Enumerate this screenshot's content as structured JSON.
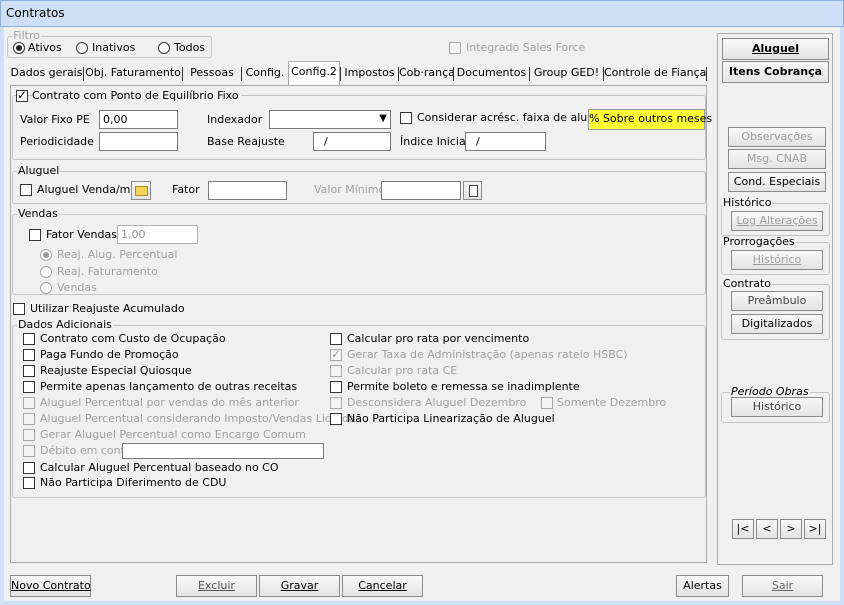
{
  "window": {
    "title": "Contratos"
  },
  "filtro": {
    "legend": "Filtro",
    "options": [
      "Ativos",
      "Inativos",
      "Todos"
    ],
    "selected": "Ativos",
    "integrado_label": "Integrado Sales Force"
  },
  "tabs": [
    "Dados gerais",
    "Obj. Faturamento",
    "Pessoas",
    "Config.",
    "Config.2",
    "Impostos",
    "Cob·rança",
    "Documentos",
    "Group GED!",
    "Controle de Fiança"
  ],
  "active_tab": "Config.2",
  "pe": {
    "legend": "Contrato com Ponto de Equilíbrio Fixo",
    "valor_fixo_label": "Valor Fixo PE",
    "valor_fixo_value": "0,00",
    "indexador_label": "Indexador",
    "indexador_value": "",
    "considerar_label": "Considerar acrésc. faixa de aluguel",
    "sobre_button": "% Sobre outros meses",
    "periodicidade_label": "Periodicidade",
    "periodicidade_value": "",
    "base_reajuste_label": "Base Reajuste",
    "base_reajuste_value": "/",
    "indice_label": "Índice Inicial",
    "indice_value": "/"
  },
  "aluguel": {
    "legend": "Aluguel",
    "venda_m2_label": "Aluguel Venda/m²",
    "fator_label": "Fator",
    "fator_value": "",
    "valor_minimo_label": "Valor Mínimo",
    "valor_minimo_value": ""
  },
  "vendas": {
    "legend": "Vendas",
    "fator_vendas_label": "Fator Vendas",
    "fator_vendas_value": "1,00",
    "options": [
      "Reaj. Alug. Percentual",
      "Reaj. Faturamento",
      "Vendas"
    ]
  },
  "reajuste_acumulado_label": "Utilizar Reajuste Acumulado",
  "dados": {
    "legend": "Dados Adicionais",
    "left": [
      "Contrato com Custo de Ocupação",
      "Paga Fundo de Promoção",
      "Reajuste Especial Quiosque",
      "Permite apenas lançamento de outras receitas",
      "Aluguel Percentual por vendas do mês anterior",
      "Aluguel Percentual considerando Imposto/Vendas Liquidas",
      "Gerar Aluguel Percentual como Encargo Comum",
      "Débito em conta",
      "Calcular Aluguel Percentual baseado no CO",
      "Não Participa Diferimento de CDU"
    ],
    "right": [
      "Calcular pro rata por vencimento",
      "Gerar Taxa de Administração (apenas rateio HSBC)",
      "Calcular pro rata CE",
      "Permite boleto e remessa se inadimplente",
      "Desconsidera Aluguel Dezembro",
      "Não Participa Linearização de Aluguel"
    ],
    "somente_dezembro": "Somente Dezembro"
  },
  "side": {
    "aluguel_button": "Aluguel",
    "itens_cobranca_button": "Itens Cobrança",
    "observacoes_button": "Observações",
    "msg_cnab_button": "Msg. CNAB",
    "cond_especiais_button": "Cond. Especiais",
    "historico_legend": "Histórico",
    "log_button": "Log Alterações",
    "prorrogacoes_legend": "Prorrogações",
    "prorrogacoes_button": "Histórico",
    "contrato_legend": "Contrato",
    "preambulo_button": "Preâmbulo",
    "digitalizados_button": "Digitalizados",
    "periodo_legend": "Período Obras",
    "periodo_button": "Histórico",
    "nav": [
      "|<",
      "<",
      ">",
      ">|"
    ]
  },
  "bottom": {
    "novo": "Novo Contrato",
    "excluir": "Excluir",
    "gravar": "Gravar",
    "cancelar": "Cancelar",
    "alertas": "Alertas",
    "sair": "Sair"
  }
}
